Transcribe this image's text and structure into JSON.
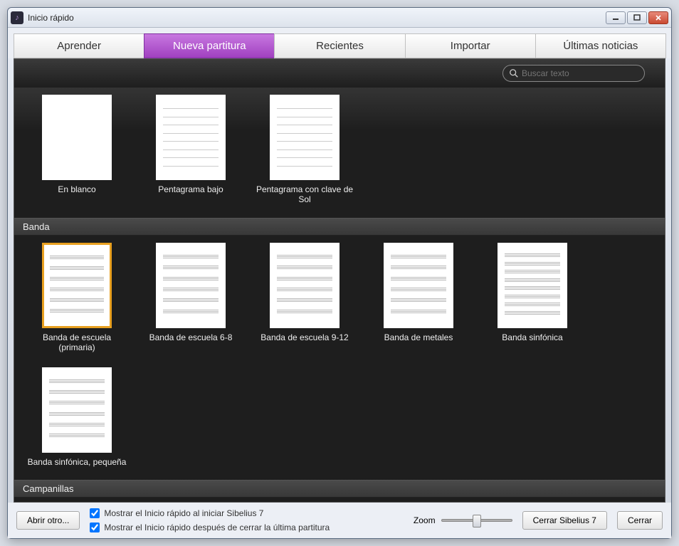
{
  "window": {
    "title": "Inicio rápido"
  },
  "tabs": [
    {
      "label": "Aprender"
    },
    {
      "label": "Nueva partitura"
    },
    {
      "label": "Recientes"
    },
    {
      "label": "Importar"
    },
    {
      "label": "Últimas noticias"
    }
  ],
  "active_tab_index": 1,
  "search": {
    "placeholder": "Buscar texto"
  },
  "section_top": {
    "templates": [
      {
        "label": "En blanco",
        "thumb": "blank"
      },
      {
        "label": "Pentagrama bajo",
        "thumb": "single"
      },
      {
        "label": "Pentagrama con clave de Sol",
        "thumb": "single"
      }
    ]
  },
  "sections": [
    {
      "name": "Banda",
      "templates": [
        {
          "label": "Banda de escuela (primaria)",
          "thumb": "multi",
          "selected": true
        },
        {
          "label": "Banda de escuela 6-8",
          "thumb": "multi"
        },
        {
          "label": "Banda de escuela 9-12",
          "thumb": "multi"
        },
        {
          "label": "Banda de metales",
          "thumb": "multi"
        },
        {
          "label": "Banda sinfónica",
          "thumb": "multi"
        },
        {
          "label": "Banda sinfónica, pequeña",
          "thumb": "multi"
        }
      ]
    },
    {
      "name": "Campanillas",
      "templates": []
    }
  ],
  "bottom": {
    "open_other": "Abrir otro...",
    "check1": "Mostrar el Inicio rápido al iniciar Sibelius 7",
    "check2": "Mostrar el Inicio rápido después de cerrar la última partitura",
    "zoom_label": "Zoom",
    "close_app": "Cerrar Sibelius 7",
    "close": "Cerrar"
  }
}
